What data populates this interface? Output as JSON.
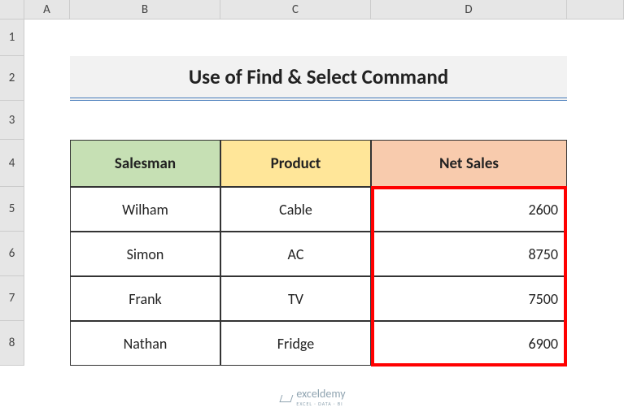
{
  "columns": {
    "A": "A",
    "B": "B",
    "C": "C",
    "D": "D"
  },
  "rows": {
    "1": "1",
    "2": "2",
    "3": "3",
    "4": "4",
    "5": "5",
    "6": "6",
    "7": "7",
    "8": "8"
  },
  "title": "Use of Find & Select Command",
  "headers": {
    "salesman": "Salesman",
    "product": "Product",
    "net_sales": "Net Sales"
  },
  "data": [
    {
      "salesman": "Wilham",
      "product": "Cable",
      "net_sales": "2600"
    },
    {
      "salesman": "Simon",
      "product": "AC",
      "net_sales": "8750"
    },
    {
      "salesman": "Frank",
      "product": "TV",
      "net_sales": "7500"
    },
    {
      "salesman": "Nathan",
      "product": "Fridge",
      "net_sales": "6900"
    }
  ],
  "logo": {
    "name": "exceldemy",
    "tagline": "EXCEL · DATA · BI"
  },
  "chart_data": {
    "type": "table",
    "title": "Use of Find & Select Command",
    "columns": [
      "Salesman",
      "Product",
      "Net Sales"
    ],
    "rows": [
      [
        "Wilham",
        "Cable",
        2600
      ],
      [
        "Simon",
        "AC",
        8750
      ],
      [
        "Frank",
        "TV",
        7500
      ],
      [
        "Nathan",
        "Fridge",
        6900
      ]
    ],
    "highlighted_range": "D5:D8"
  }
}
